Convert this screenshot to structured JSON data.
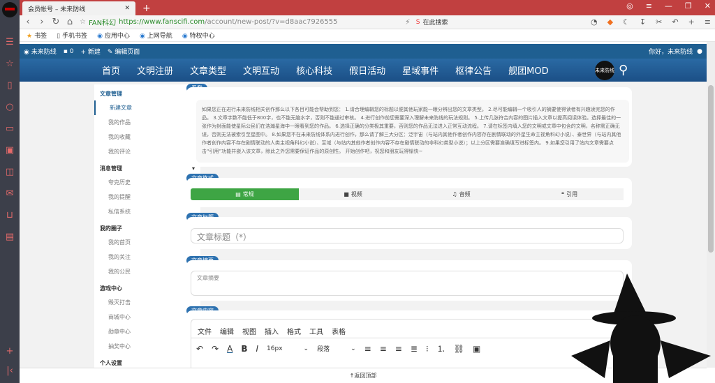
{
  "browser": {
    "tab_title": "会员帐号 – 未来防线",
    "url_site": "FAN科幻",
    "url_scheme_host": "https://www.fanscifi.com",
    "url_path": "/account/new-post/?v=d8aac7926555",
    "search_placeholder": "在此搜索",
    "bookmarks": [
      "书签",
      "手机书签",
      "应用中心",
      "上网导航",
      "特权中心"
    ]
  },
  "wp_bar": {
    "site": "未来防线",
    "comments": "0",
    "new": "新建",
    "edit": "编辑页面",
    "greeting": "你好，未来防线"
  },
  "nav": {
    "items": [
      "首页",
      "文明注册",
      "文章类型",
      "文明互动",
      "核心科技",
      "假日活动",
      "星域事件",
      "枢律公告",
      "舰团MOD"
    ],
    "logo_text": "未来防线"
  },
  "sidebar": {
    "groups": [
      {
        "title": "文章管理",
        "items": [
          "新建文章",
          "我的作品",
          "我的收藏",
          "我的评论"
        ]
      },
      {
        "title": "消息管理",
        "items": [
          "夸克历史",
          "我的提醒",
          "私信系统"
        ]
      },
      {
        "title": "我的圈子",
        "items": [
          "我的首页",
          "我的关注",
          "我的公民"
        ]
      },
      {
        "title": "游戏中心",
        "items": [
          "毁灭打击",
          "商城中心",
          "勋章中心",
          "抽奖中心"
        ]
      },
      {
        "title": "个人设置",
        "items": []
      }
    ]
  },
  "notice": {
    "tag": "看我",
    "text": "如果您正在进行未来防线相关创作那么以下各目可能会帮助到您： 1.请合理编辑您的标题以便其他玩家能一眼分辨出您的文章类型。 2.尽可能编辑一个吸引人的摘要使得读者有兴趣读完您的作品。 3.文章字数不能低于800字，也不能无脑水字，否则不能通过审核。 4.进行创作前您需要深入理解未来防线的玩法规则。 5.上传几张符合内容的图片插入文章以提高阅读体验。选择最佳的一张作为封面能使星际公民们在浩瀚星海中一眼看到您的作品。 6.选择正确的分类极其重要，否则您的作品无法进入正常互动流程。 7.请在标签内填入您的文明或文章中包含的文明，名称需正确无误，否则无法被索引至星图中。 8.如果您不在未来防线体系内进行创作，那么请了解三大分区：泛宇宙（与站内其他作者创作内容存在剧情联动的外星生命主视角科幻小说）、泰世界（与站内其他作者创作内容不存在剧情联动的人类主视角科幻小说）、至域（与站内其他作者创作内容不存在剧情联动的非科幻类型小说）；以上分区需要准确填写进标签内。 9.如果您引用了站内文章需要点击“引用”功能并嵌入该文章，除此之外您需要保证作品的原创性。 开始创作吧，祝您和朋友玩得愉快~"
  },
  "format": {
    "tag": "文章格式",
    "options": [
      "常规",
      "视频",
      "音频",
      "引用"
    ]
  },
  "title_field": {
    "tag": "文章标题",
    "placeholder": "文章标题（*）"
  },
  "excerpt": {
    "tag": "文章摘要",
    "placeholder": "文章摘要"
  },
  "editor": {
    "tag": "文章内容",
    "menu": [
      "文件",
      "编辑",
      "视图",
      "插入",
      "格式",
      "工具",
      "表格"
    ],
    "font_size": "16px",
    "block": "段落"
  },
  "footer": {
    "back_top": "返回顶部"
  }
}
